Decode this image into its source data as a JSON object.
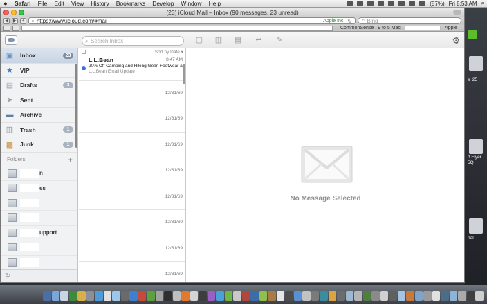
{
  "menubar": {
    "app": "Safari",
    "items": [
      "File",
      "Edit",
      "View",
      "History",
      "Bookmarks",
      "Develop",
      "Window",
      "Help"
    ],
    "battery": "(87%)",
    "clock": "Fri 8:53 AM"
  },
  "window": {
    "title": "(23) iCloud Mail – Inbox (90 messages, 23 unread)",
    "url": "https://www.icloud.com/#mail",
    "secure_label": "Apple Inc.",
    "search_placeholder": "Bing",
    "bookmarks": [
      "CommonSense",
      "9 to 5 Mac",
      "Apple"
    ]
  },
  "mail": {
    "search_placeholder": "Search Inbox",
    "sort_label": "Sort by Date",
    "mailboxes": [
      {
        "label": "Inbox",
        "badge": "23",
        "icon": "inbox-icon",
        "glyph": "▣",
        "color": "#6a8fc6"
      },
      {
        "label": "VIP",
        "badge": "",
        "icon": "star-icon",
        "glyph": "★",
        "color": "#3d74c9"
      },
      {
        "label": "Drafts",
        "badge": "3",
        "icon": "drafts-icon",
        "glyph": "▤",
        "color": "#9aa3ad"
      },
      {
        "label": "Sent",
        "badge": "",
        "icon": "sent-icon",
        "glyph": "➤",
        "color": "#9aa3ad"
      },
      {
        "label": "Archive",
        "badge": "",
        "icon": "archive-icon",
        "glyph": "▬",
        "color": "#5d7fa6"
      },
      {
        "label": "Trash",
        "badge": "1",
        "icon": "trash-icon",
        "glyph": "▥",
        "color": "#8a8f96"
      },
      {
        "label": "Junk",
        "badge": "1",
        "icon": "junk-icon",
        "glyph": "▩",
        "color": "#c98d3b"
      }
    ],
    "folders_label": "Folders",
    "folders": [
      "n",
      "es",
      "",
      "",
      "upport",
      "",
      ""
    ],
    "messages": [
      {
        "sender": "L.L.Bean",
        "time": "8:47 AM",
        "subject": "20% Off Camping and Hiking Gear, Footwear a...",
        "preview": "L.L.Bean Email Update",
        "unread": true
      },
      {
        "date": "12/31/69"
      },
      {
        "date": "12/31/69"
      },
      {
        "date": "12/31/69"
      },
      {
        "date": "12/31/69"
      },
      {
        "date": "12/31/69"
      },
      {
        "date": "12/31/69"
      },
      {
        "date": "12/31/69"
      },
      {
        "date": "12/31/69"
      }
    ],
    "empty_text": "No Message Selected"
  },
  "desktop": {
    "labels": [
      "s_25",
      "d Flyer",
      "5Q",
      "nal"
    ]
  },
  "dock_colors": [
    "#4a6fa5",
    "#7aa7d8",
    "#c9d5e3",
    "#3c8b3a",
    "#d8b04a",
    "#8b8f99",
    "#4f9bd9",
    "#e0e0e0",
    "#9cc7ec",
    "#6a6a6a",
    "#3f7fcf",
    "#c64a3a",
    "#5e9f3e",
    "#a3a3a3",
    "#2f2f2f",
    "#bfbfbf",
    "#e07a2e",
    "#d4d4d4",
    "#3d3d3d",
    "#9a5fc2",
    "#4aa0d8",
    "#6fb843",
    "#c9c9c9",
    "#b0463d",
    "#3b6ea8",
    "#8fbf4f",
    "#a97b45",
    "#e6e6e6",
    "#4d4d4d",
    "#5a8fd1",
    "#c2c2c2",
    "#7a7a7a",
    "#3a8c9f",
    "#d9a441",
    "#6c6c6c",
    "#9fb8d1",
    "#b5b5b5",
    "#4e7f3f",
    "#8a8a8a",
    "#d0d0d0",
    "#5f5f5f",
    "#a4c4e4",
    "#c77a3b",
    "#7fa3c9",
    "#9b9b9b",
    "#e1e1e1",
    "#4c6c8c",
    "#8fb3d7",
    "#aaaaaa",
    "#3f3f3f",
    "#cfcfcf"
  ]
}
